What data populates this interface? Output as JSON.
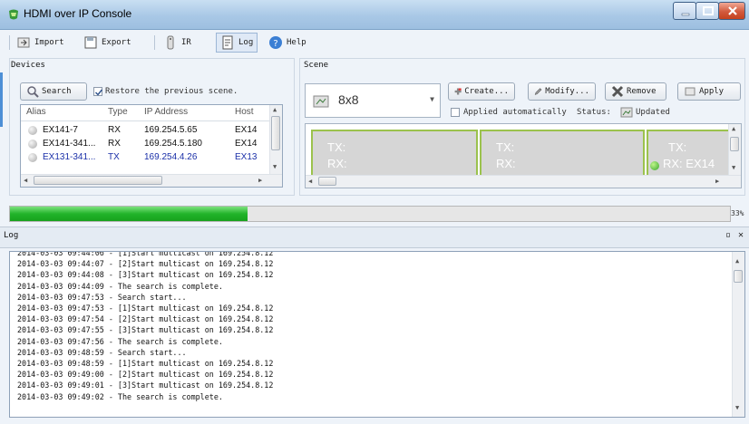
{
  "window": {
    "title": "HDMI over IP Console"
  },
  "toolbar": {
    "import_label": "Import",
    "export_label": "Export",
    "ir_label": "IR",
    "log_label": "Log",
    "help_label": "Help"
  },
  "devices": {
    "title": "Devices",
    "search_label": "Search",
    "restore_label": "Restore the previous scene.",
    "restore_checked": true,
    "columns": [
      "Alias",
      "Type",
      "IP Address",
      "Host"
    ],
    "rows": [
      {
        "alias": "EX141-7",
        "type": "RX",
        "ip": "169.254.5.65",
        "host": "EX14"
      },
      {
        "alias": "EX141-341...",
        "type": "RX",
        "ip": "169.254.5.180",
        "host": "EX14"
      },
      {
        "alias": "EX131-341...",
        "type": "TX",
        "ip": "169.254.4.26",
        "host": "EX13"
      }
    ]
  },
  "scene": {
    "title": "Scene",
    "selected": "8x8",
    "create_label": "Create...",
    "modify_label": "Modify...",
    "remove_label": "Remove",
    "apply_label": "Apply",
    "applied_auto_label": "Applied automatically",
    "status_label": "Status:",
    "status_value": "Updated",
    "tiles": [
      {
        "tx": "TX:",
        "rx": "RX:"
      },
      {
        "tx": "TX:",
        "rx": "RX:"
      },
      {
        "tx": "TX:",
        "rx": "RX: EX14"
      }
    ]
  },
  "progress": {
    "value": 0.33,
    "label": "33%"
  },
  "log": {
    "title": "Log",
    "lines": [
      "2014-03-03 09:44:06 - [1]Start multicast on 169.254.8.12",
      "2014-03-03 09:44:07 - [2]Start multicast on 169.254.8.12",
      "2014-03-03 09:44:08 - [3]Start multicast on 169.254.8.12",
      "2014-03-03 09:44:09 - The search is complete.",
      "2014-03-03 09:47:53 - Search start...",
      "2014-03-03 09:47:53 - [1]Start multicast on 169.254.8.12",
      "2014-03-03 09:47:54 - [2]Start multicast on 169.254.8.12",
      "2014-03-03 09:47:55 - [3]Start multicast on 169.254.8.12",
      "2014-03-03 09:47:56 - The search is complete.",
      "2014-03-03 09:48:59 - Search start...",
      "2014-03-03 09:48:59 - [1]Start multicast on 169.254.8.12",
      "2014-03-03 09:49:00 - [2]Start multicast on 169.254.8.12",
      "2014-03-03 09:49:01 - [3]Start multicast on 169.254.8.12",
      "2014-03-03 09:49:02 - The search is complete."
    ]
  },
  "colors": {
    "progress_green": "#22b42a",
    "tile_border": "#9bc24d",
    "selected_row_text": "#1a2fa8"
  }
}
